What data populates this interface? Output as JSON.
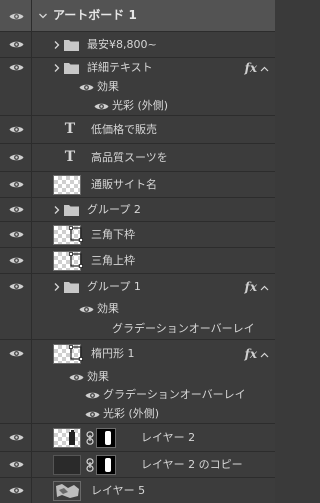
{
  "layers_panel": {
    "artboard": {
      "label": "アートボード 1"
    },
    "rows": [
      {
        "id": "grp-min-price",
        "label": "最安¥8,800~"
      },
      {
        "id": "grp-detail-text",
        "label": "詳細テキスト",
        "fx": "fx"
      },
      {
        "id": "detail-effects",
        "label": "効果"
      },
      {
        "id": "detail-outer-glow",
        "label": "光彩 (外側)"
      },
      {
        "id": "txt-low-price",
        "label": "低価格で販売"
      },
      {
        "id": "txt-suits",
        "label": "高品質スーツを"
      },
      {
        "id": "layer-shop-name",
        "label": "通販サイト名"
      },
      {
        "id": "grp-group2",
        "label": "グループ 2"
      },
      {
        "id": "layer-tri-bottom",
        "label": "三角下枠"
      },
      {
        "id": "layer-tri-top",
        "label": "三角上枠"
      },
      {
        "id": "grp-group1",
        "label": "グループ 1",
        "fx": "fx"
      },
      {
        "id": "group1-effects",
        "label": "効果"
      },
      {
        "id": "group1-gradient",
        "label": "グラデーションオーバーレイ"
      },
      {
        "id": "layer-ellipse1",
        "label": "楕円形 1",
        "fx": "fx"
      },
      {
        "id": "ellipse-effects",
        "label": "効果"
      },
      {
        "id": "ellipse-gradient",
        "label": "グラデーションオーバーレイ"
      },
      {
        "id": "ellipse-outer-glow",
        "label": "光彩 (外側)"
      },
      {
        "id": "layer-2",
        "label": "レイヤー 2"
      },
      {
        "id": "layer-2-copy",
        "label": "レイヤー 2 のコピー"
      },
      {
        "id": "layer-5",
        "label": "レイヤー 5"
      }
    ]
  },
  "colors": {
    "panel_bg": "#3c3c3c",
    "selected_bg": "#535353",
    "text": "#d6d6d6",
    "divider": "#2c2c2c"
  },
  "icons": {
    "visibility": "eye-icon",
    "expand": "chevron-right-icon",
    "collapse": "chevron-down-icon",
    "group": "folder-icon",
    "text_layer": "text-type-icon",
    "effects": "fx-icon",
    "link": "link-icon"
  }
}
